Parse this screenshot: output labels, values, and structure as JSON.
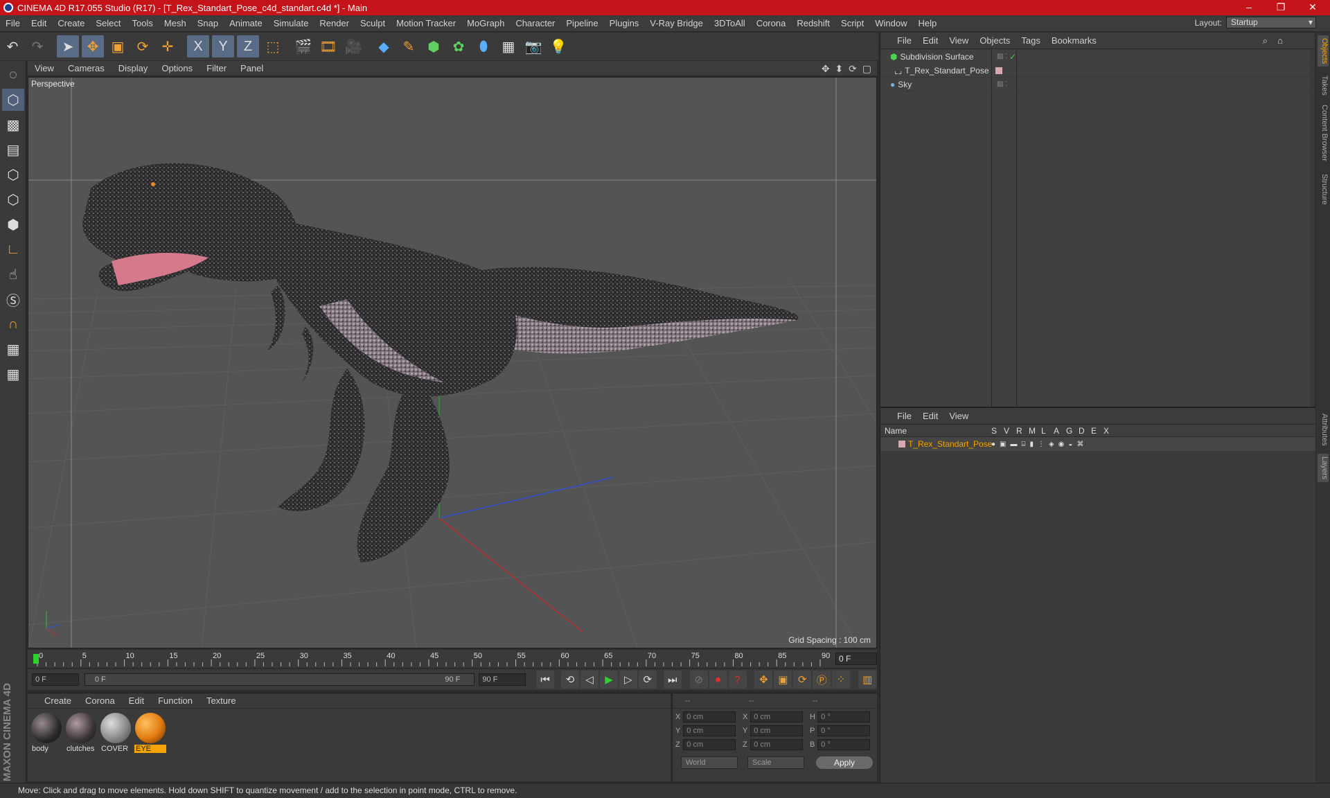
{
  "title": "CINEMA 4D R17.055 Studio (R17) - [T_Rex_Standart_Pose_c4d_standart.c4d *] - Main",
  "menu": [
    "File",
    "Edit",
    "Create",
    "Select",
    "Tools",
    "Mesh",
    "Snap",
    "Animate",
    "Simulate",
    "Render",
    "Sculpt",
    "Motion Tracker",
    "MoGraph",
    "Character",
    "Pipeline",
    "Plugins",
    "V-Ray Bridge",
    "3DToAll",
    "Corona",
    "Redshift",
    "Script",
    "Window",
    "Help"
  ],
  "layout_label": "Layout:",
  "layout_value": "Startup",
  "toolbar_letters": [
    "X",
    "Y",
    "Z"
  ],
  "viewport": {
    "menu": [
      "View",
      "Cameras",
      "Display",
      "Options",
      "Filter",
      "Panel"
    ],
    "label": "Perspective",
    "grid_spacing": "Grid Spacing : 100 cm"
  },
  "timeline": {
    "ticks": [
      "0",
      "5",
      "10",
      "15",
      "20",
      "25",
      "30",
      "35",
      "40",
      "45",
      "50",
      "55",
      "60",
      "65",
      "70",
      "75",
      "80",
      "85",
      "90"
    ],
    "frame_field": "0 F"
  },
  "transport": {
    "start": "0 F",
    "range_start": "0 F",
    "range_end": "90 F",
    "end": "90 F"
  },
  "materials": {
    "menu": [
      "Create",
      "Corona",
      "Edit",
      "Function",
      "Texture"
    ],
    "items": [
      "body",
      "clutches",
      "COVER",
      "EYE"
    ]
  },
  "coords": {
    "header": [
      "--",
      "--",
      "--"
    ],
    "rows": [
      {
        "a": "X",
        "v1": "0 cm",
        "b": "X",
        "v2": "0 cm",
        "c": "H",
        "v3": "0 °"
      },
      {
        "a": "Y",
        "v1": "0 cm",
        "b": "Y",
        "v2": "0 cm",
        "c": "P",
        "v3": "0 °"
      },
      {
        "a": "Z",
        "v1": "0 cm",
        "b": "Z",
        "v2": "0 cm",
        "c": "B",
        "v3": "0 °"
      }
    ],
    "world": "World",
    "scale": "Scale",
    "apply": "Apply"
  },
  "status": "Move: Click and drag to move elements. Hold down SHIFT to quantize movement / add to the selection in point mode, CTRL to remove.",
  "objects": {
    "menu": [
      "File",
      "Edit",
      "View",
      "Objects",
      "Tags",
      "Bookmarks"
    ],
    "rows": [
      "Subdivision Surface",
      "T_Rex_Standart_Pose",
      "Sky"
    ]
  },
  "layers": {
    "menu": [
      "File",
      "Edit",
      "View"
    ],
    "headers": [
      "Name",
      "S",
      "V",
      "R",
      "M",
      "L",
      "A",
      "G",
      "D",
      "E",
      "X"
    ],
    "row": "T_Rex_Standart_Pose"
  },
  "sidetabs": [
    "Objects",
    "Takes",
    "Content Browser",
    "Structure",
    "Attributes",
    "Layers"
  ],
  "maxon": "MAXON CINEMA 4D",
  "colors": {
    "title_bar": "#c4141a",
    "accent": "#f3a400"
  }
}
